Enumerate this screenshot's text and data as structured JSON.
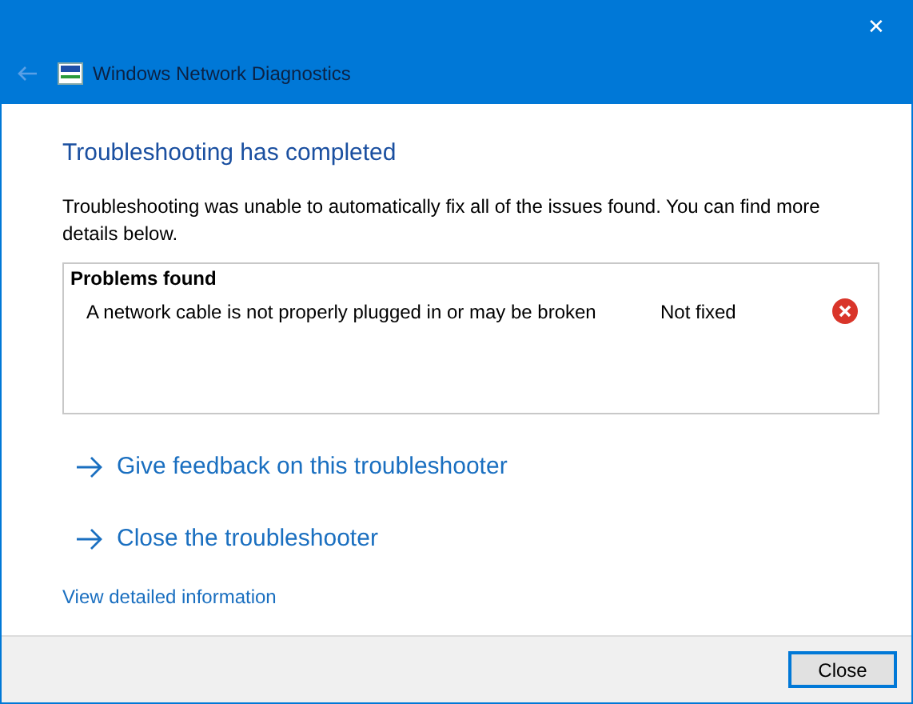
{
  "window": {
    "title": "Windows Network Diagnostics",
    "close_glyph": "✕"
  },
  "heading": "Troubleshooting has completed",
  "description": "Troubleshooting was unable to automatically fix all of the issues found. You can find more details below.",
  "problems": {
    "title": "Problems found",
    "items": [
      {
        "text": "A network cable is not properly plugged in or may be broken",
        "status": "Not fixed",
        "fixed": false
      }
    ]
  },
  "actions": [
    {
      "label": "Give feedback on this troubleshooter"
    },
    {
      "label": "Close the troubleshooter"
    }
  ],
  "details_link": "View detailed information",
  "buttons": [
    "Close"
  ]
}
